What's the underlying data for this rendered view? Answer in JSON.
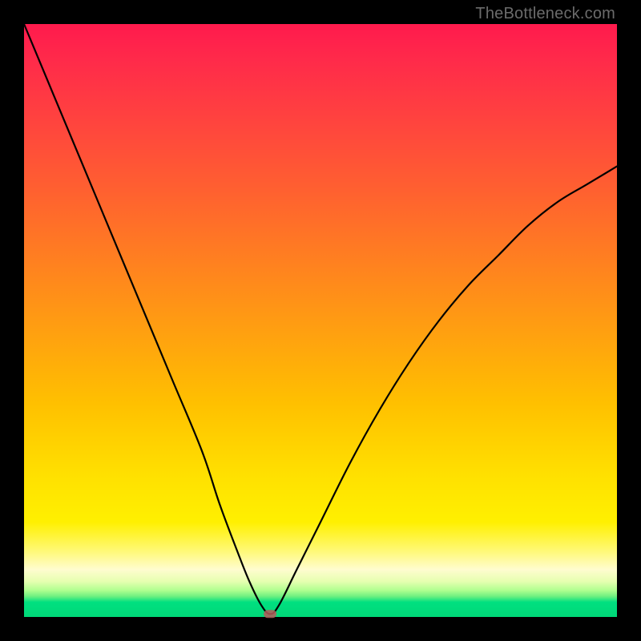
{
  "watermark": "TheBottleneck.com",
  "chart_data": {
    "type": "line",
    "title": "",
    "xlabel": "",
    "ylabel": "",
    "xlim": [
      0,
      100
    ],
    "ylim": [
      0,
      100
    ],
    "grid": false,
    "legend": false,
    "annotations": [],
    "series": [
      {
        "name": "curve",
        "x": [
          0,
          5,
          10,
          15,
          20,
          25,
          30,
          33,
          36,
          38,
          40,
          41.5,
          43,
          46,
          50,
          55,
          60,
          65,
          70,
          75,
          80,
          85,
          90,
          95,
          100
        ],
        "y": [
          100,
          88,
          76,
          64,
          52,
          40,
          28,
          19,
          11,
          6,
          2,
          0.5,
          2,
          8,
          16,
          26,
          35,
          43,
          50,
          56,
          61,
          66,
          70,
          73,
          76
        ]
      }
    ],
    "marker": {
      "x": 41.5,
      "y": 0.5,
      "color": "#b55a5a"
    },
    "background_gradient": {
      "top": "#ff1a4d",
      "mid": "#ffe000",
      "bottom": "#00d878"
    }
  }
}
